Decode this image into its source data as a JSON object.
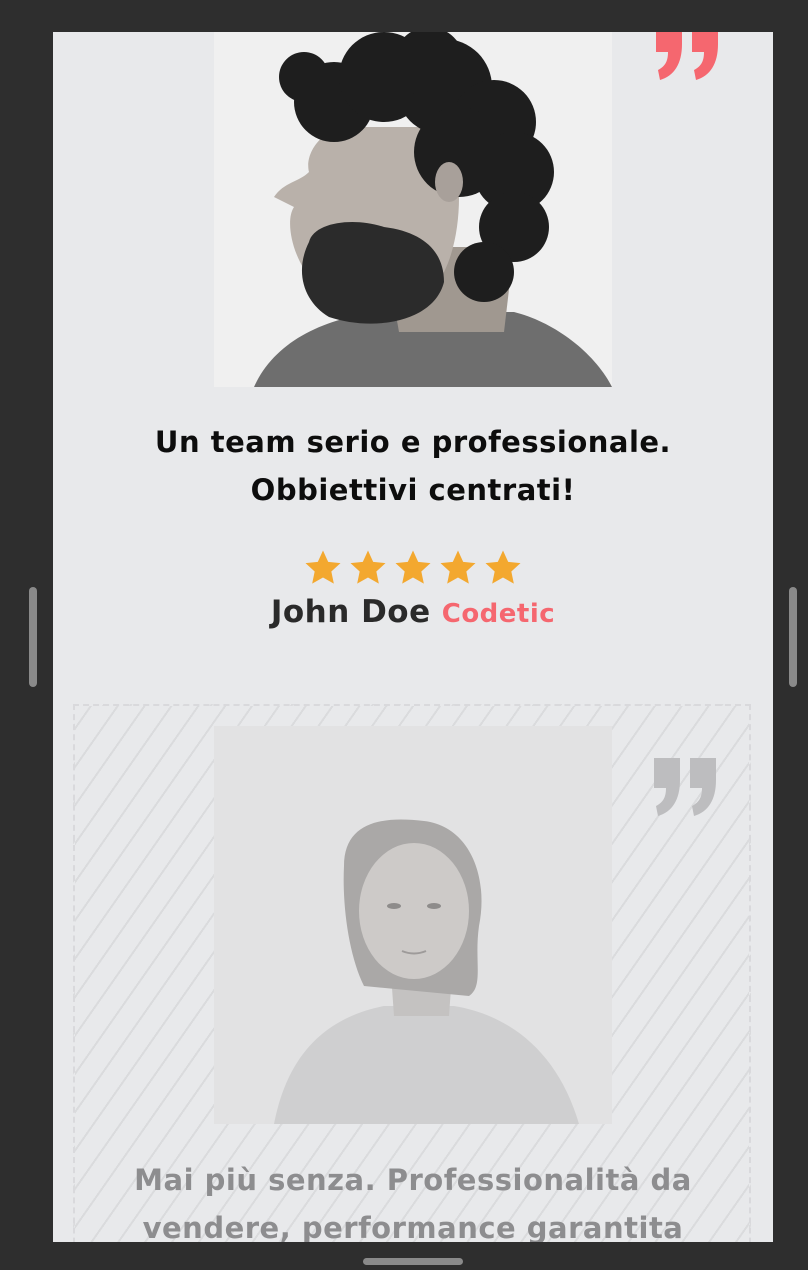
{
  "colors": {
    "background": "#2e2e2e",
    "panel": "#e8e9eb",
    "accent": "#f5676f",
    "star": "#f3a82f",
    "muted_text": "#8d8d8f"
  },
  "testimonials": [
    {
      "photo_icon": "portrait-man-curly-hair-profile",
      "quote_icon": "quote-mark-icon",
      "text_line1": "Un team serio e professionale.",
      "text_line2": "Obbiettivi centrati!",
      "rating": 5,
      "rating_max": 5,
      "author": "John Doe",
      "company": "Codetic"
    },
    {
      "photo_icon": "portrait-woman",
      "quote_icon": "quote-mark-icon",
      "text_line1": "Mai più senza. Professionalità da",
      "text_line2": "vendere, performance garantita"
    }
  ]
}
